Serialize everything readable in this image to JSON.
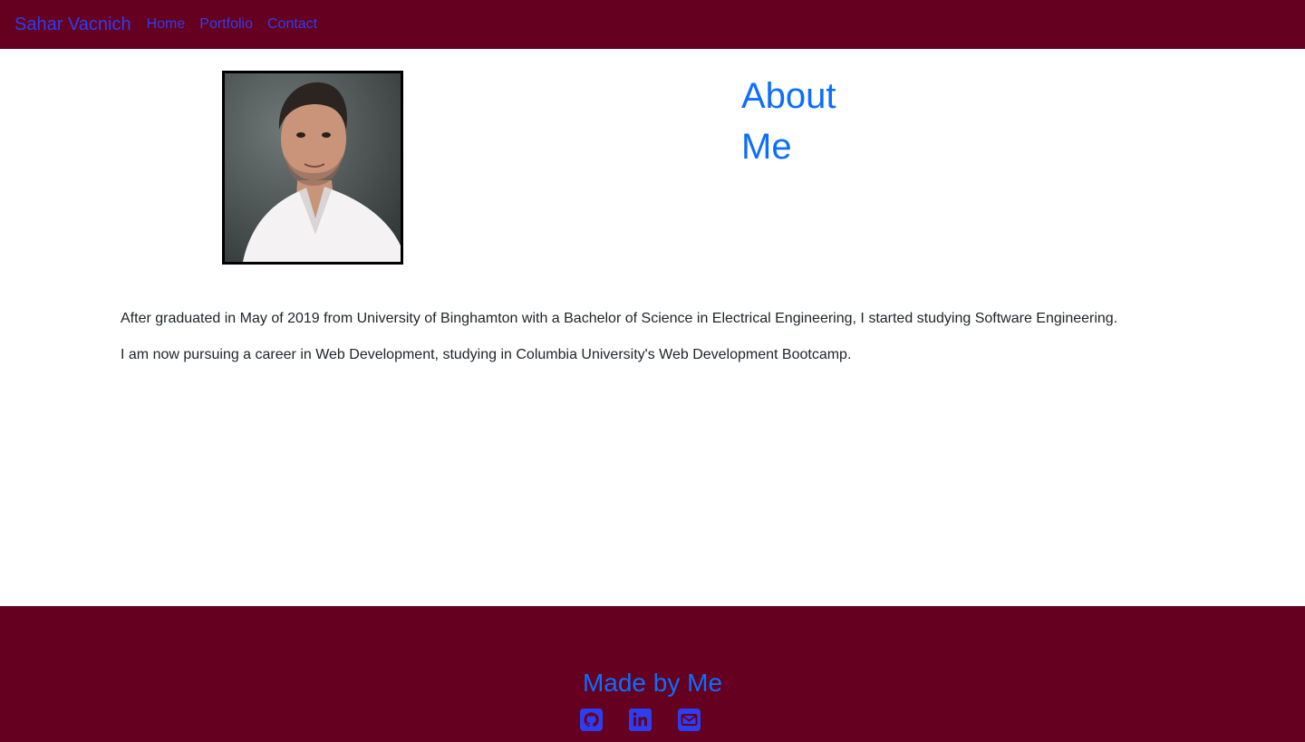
{
  "navbar": {
    "brand": "Sahar Vacnich",
    "links": [
      {
        "label": "Home"
      },
      {
        "label": "Portfolio"
      },
      {
        "label": "Contact"
      }
    ]
  },
  "about": {
    "heading": "About Me",
    "paragraphs": [
      "After graduated in May of 2019 from University of Binghamton with a Bachelor of Science in Electrical Engineering, I started studying Software Engineering.",
      "I am now pursuing a career in Web Development, studying in Columbia University's Web Development Bootcamp."
    ]
  },
  "footer": {
    "title": "Made by Me",
    "social": [
      {
        "icon": "github-icon"
      },
      {
        "icon": "linkedin-icon"
      },
      {
        "icon": "email-icon"
      }
    ]
  },
  "colors": {
    "navbar_bg": "#650020",
    "link": "#2d3ef0",
    "heading": "#0d6efd",
    "text": "#212529"
  }
}
